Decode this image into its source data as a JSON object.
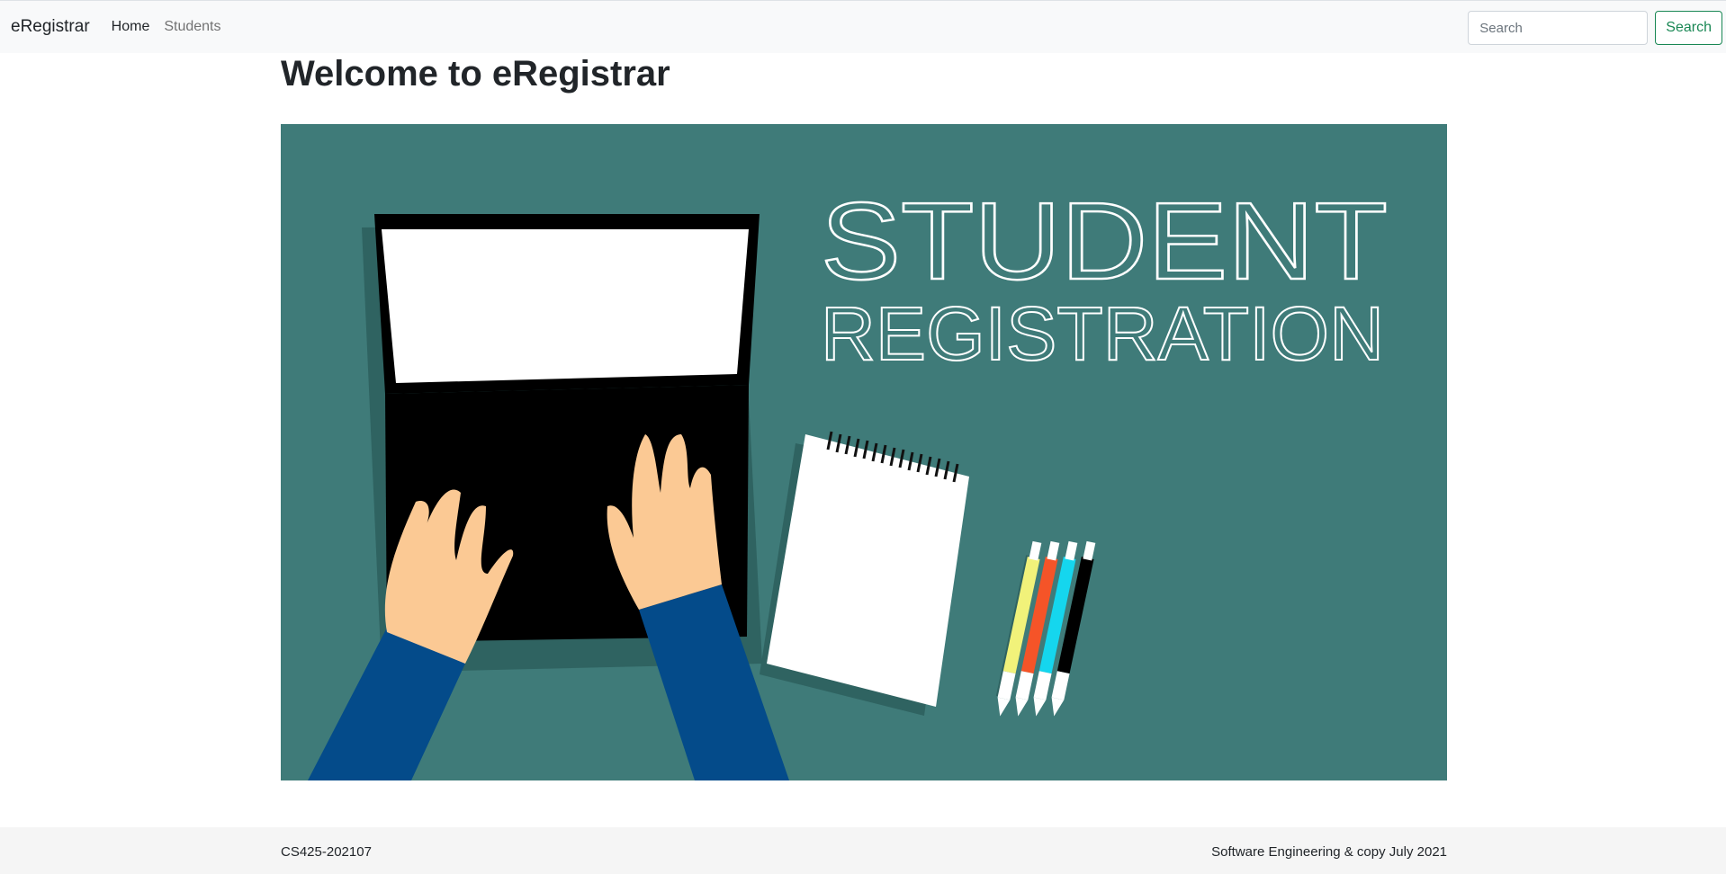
{
  "navbar": {
    "brand": "eRegistrar",
    "links": [
      {
        "label": "Home",
        "active": true
      },
      {
        "label": "Students",
        "active": false
      }
    ],
    "search": {
      "placeholder": "Search",
      "value": "",
      "button_label": "Search"
    }
  },
  "main": {
    "title": "Welcome to eRegistrar",
    "hero": {
      "line1": "STUDENT",
      "line2": "REGISTRATION",
      "background_color": "#3f7b79"
    }
  },
  "footer": {
    "left_text": "CS425-202107",
    "right_text": "Software Engineering & copy July 2021"
  },
  "colors": {
    "navbar_bg": "#f8f9fa",
    "accent_green": "#198754",
    "footer_bg": "#f5f5f5"
  }
}
